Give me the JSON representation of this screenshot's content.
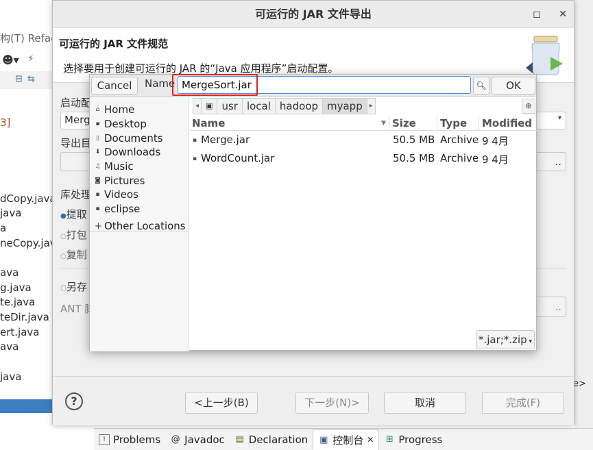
{
  "window": {
    "title": "可运行的 JAR 文件导出",
    "minimize_icon": "square-minimize-icon",
    "close_icon": "close-icon"
  },
  "background": {
    "menu_text": "构(T)  Refac",
    "files": [
      "dCopy.java",
      "java",
      "a",
      "neCopy.java",
      "ava",
      "g.java",
      "te.java",
      "teDir.java",
      "ert.java",
      "ava",
      "java"
    ],
    "tag": "e>"
  },
  "bottom_tabs": [
    {
      "label": "Problems",
      "icon": "problems-icon"
    },
    {
      "label": "Javadoc",
      "icon": "at-icon"
    },
    {
      "label": "Declaration",
      "icon": "declaration-icon"
    },
    {
      "label": "控制台",
      "icon": "console-icon",
      "close": "✕"
    },
    {
      "label": "Progress",
      "icon": "progress-icon"
    }
  ],
  "spec": {
    "title": "可运行的 JAR 文件规范",
    "description": "选择要用于创建可运行的 JAR 的“Java 应用程序”启动配置。"
  },
  "form": {
    "launch_label": "启动配",
    "launch_value": "Merg",
    "export_label": "导出目",
    "library_label": "库处理",
    "radio_extract": "提取",
    "radio_package": "打包",
    "radio_copy": "复制",
    "save_as": "另存",
    "ant_label": "ANT 脚"
  },
  "footer": {
    "back": "<上一步(B)",
    "next": "下一步(N)>",
    "cancel": "取消",
    "finish": "完成(F)"
  },
  "chooser": {
    "cancel": "Cancel",
    "name_label": "Name",
    "name_value": "MergeSort.jar",
    "ok": "OK",
    "places": [
      {
        "label": "Home",
        "icon": "home-icon"
      },
      {
        "label": "Desktop",
        "icon": "folder-icon"
      },
      {
        "label": "Documents",
        "icon": "document-icon"
      },
      {
        "label": "Downloads",
        "icon": "download-icon"
      },
      {
        "label": "Music",
        "icon": "music-icon"
      },
      {
        "label": "Pictures",
        "icon": "picture-icon"
      },
      {
        "label": "Videos",
        "icon": "video-icon"
      },
      {
        "label": "eclipse",
        "icon": "folder-icon"
      }
    ],
    "other_locations": "Other Locations",
    "path": [
      "usr",
      "local",
      "hadoop",
      "myapp"
    ],
    "columns": {
      "name": "Name",
      "size": "Size",
      "type": "Type",
      "modified": "Modified"
    },
    "files": [
      {
        "name": "Merge.jar",
        "size": "50.5 MB",
        "type": "Archive",
        "modified": "9 4月"
      },
      {
        "name": "WordCount.jar",
        "size": "50.5 MB",
        "type": "Archive",
        "modified": "9 4月"
      }
    ],
    "filter": "*.jar;*.zip"
  }
}
